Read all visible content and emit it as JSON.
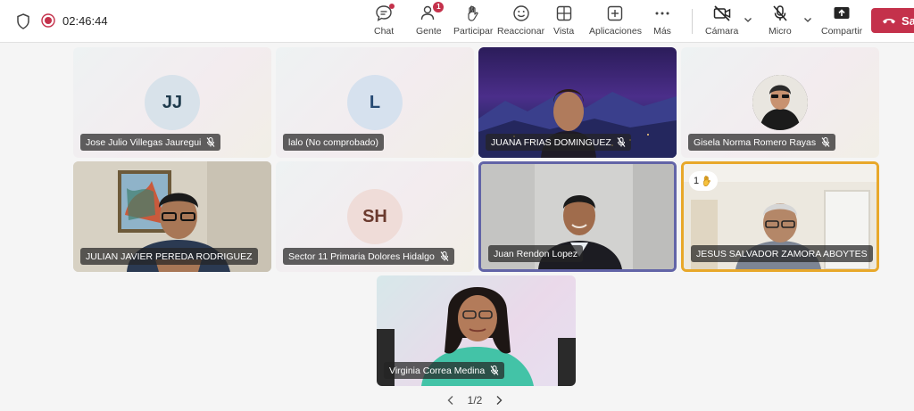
{
  "meeting": {
    "timer": "02:46:44"
  },
  "toolbar": {
    "chat": "Chat",
    "people": "Gente",
    "people_badge": "1",
    "raise": "Participar",
    "react": "Reaccionar",
    "view": "Vista",
    "apps": "Aplicaciones",
    "more": "Más",
    "camera": "Cámara",
    "mic": "Micro",
    "share": "Compartir",
    "leave": "Sa"
  },
  "participants": [
    {
      "name": "Jose Julio Villegas Jauregui",
      "initials": "JJ",
      "muted": true
    },
    {
      "name": "lalo (No comprobado)",
      "initials": "L",
      "muted": false
    },
    {
      "name": "JUANA FRIAS DOMINGUEZ",
      "muted": true
    },
    {
      "name": "Gisela Norma Romero Rayas",
      "muted": true
    },
    {
      "name": "JULIAN JAVIER PEREDA RODRIGUEZ",
      "muted": false
    },
    {
      "name": "Sector 11 Primaria Dolores Hidalgo",
      "initials": "SH",
      "muted": true
    },
    {
      "name": "Juan Rendon Lopez",
      "muted": false
    },
    {
      "name": "JESUS SALVADOR ZAMORA ABOYTES",
      "muted": false,
      "hand_order": "1"
    },
    {
      "name": "Virginia Correa Medina",
      "muted": true
    }
  ],
  "pager": {
    "label": "1/2"
  },
  "colors": {
    "leave": "#c4314b",
    "speaking_border": "#6264a7",
    "hand_border": "#e8a82a"
  }
}
